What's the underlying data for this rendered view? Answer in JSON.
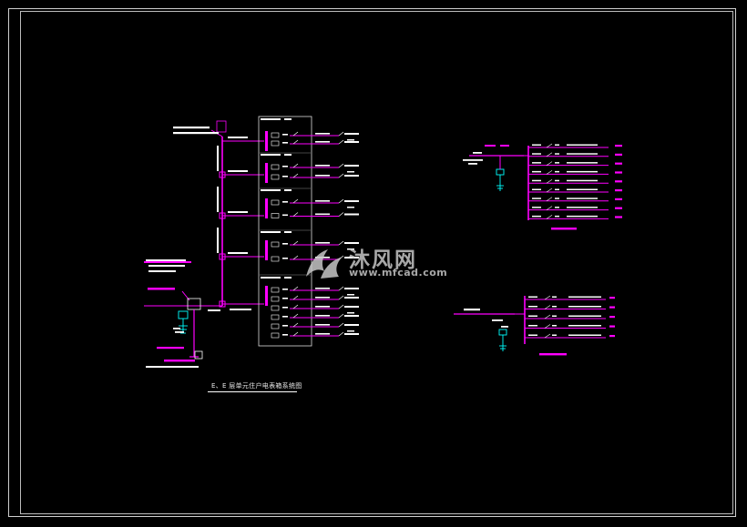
{
  "drawing": {
    "main_title": "E、E 层单元住户电表箱系统图",
    "watermark": {
      "brand": "沐风网",
      "url": "www.mfcad.com"
    }
  },
  "colors": {
    "background": "#000000",
    "bus": "#ff00ff",
    "text": "#ffffff",
    "meter": "#00ffff",
    "frame": "#cfcfcf"
  }
}
